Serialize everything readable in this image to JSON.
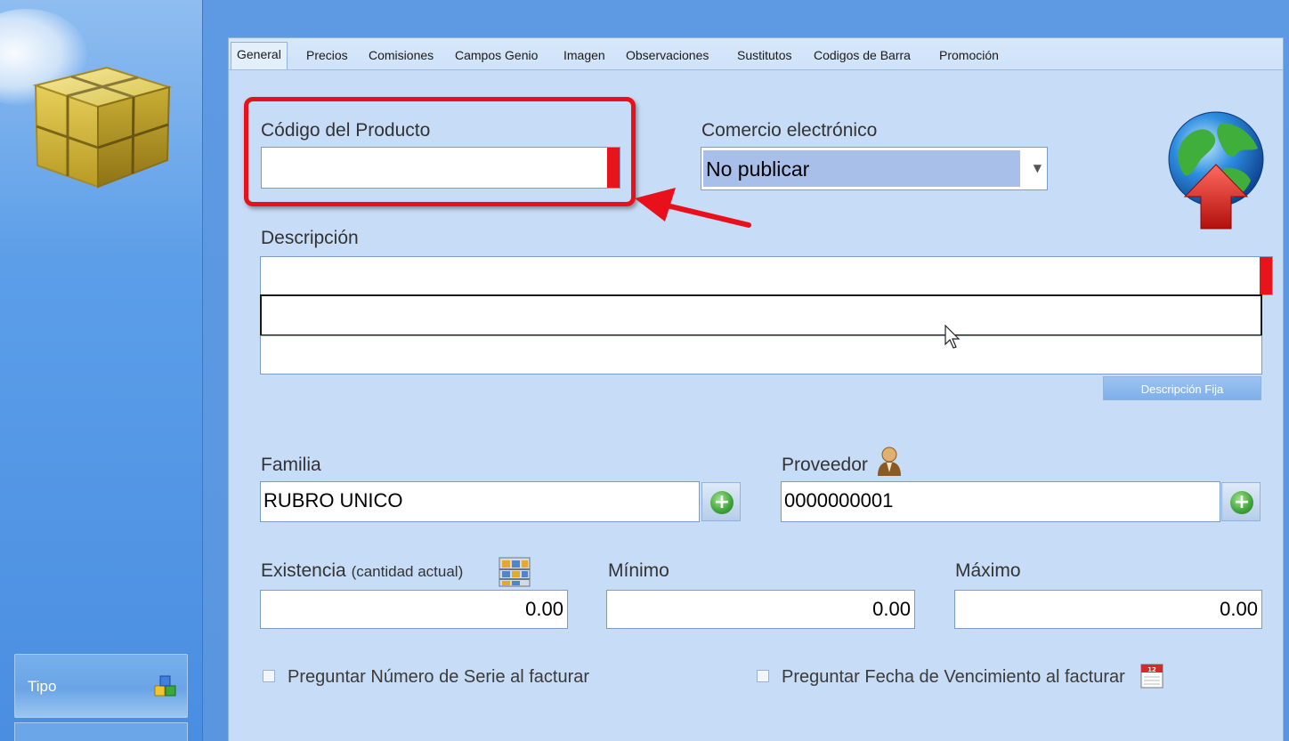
{
  "sidebar": {
    "type_button_label": "Tipo"
  },
  "tabs": [
    {
      "label": "General"
    },
    {
      "label": "Precios"
    },
    {
      "label": "Comisiones"
    },
    {
      "label": "Campos Genio"
    },
    {
      "label": "Imagen"
    },
    {
      "label": "Observaciones"
    },
    {
      "label": "Sustitutos"
    },
    {
      "label": "Codigos de Barra"
    },
    {
      "label": "Promoción"
    }
  ],
  "form": {
    "product_code_label": "Código del Producto",
    "product_code_value": "",
    "ecommerce_label": "Comercio electrónico",
    "ecommerce_value": "No publicar",
    "description_label": "Descripción",
    "description_lines": [
      "",
      "",
      ""
    ],
    "fixed_description_button": "Descripción Fija",
    "family_label": "Familia",
    "family_value": "RUBRO UNICO",
    "supplier_label": "Proveedor",
    "supplier_value": "0000000001",
    "stock_label": "Existencia",
    "stock_label_note": "(cantidad actual)",
    "stock_value": "0.00",
    "min_label": "Mínimo",
    "min_value": "0.00",
    "max_label": "Máximo",
    "max_value": "0.00",
    "ask_serial_label": "Preguntar Número de Serie al facturar",
    "ask_expiry_label": "Preguntar Fecha de Vencimiento al facturar"
  },
  "colors": {
    "required_marker": "#e8141c",
    "annotation": "#e8101a",
    "panel_bg": "#c7dcf6"
  }
}
